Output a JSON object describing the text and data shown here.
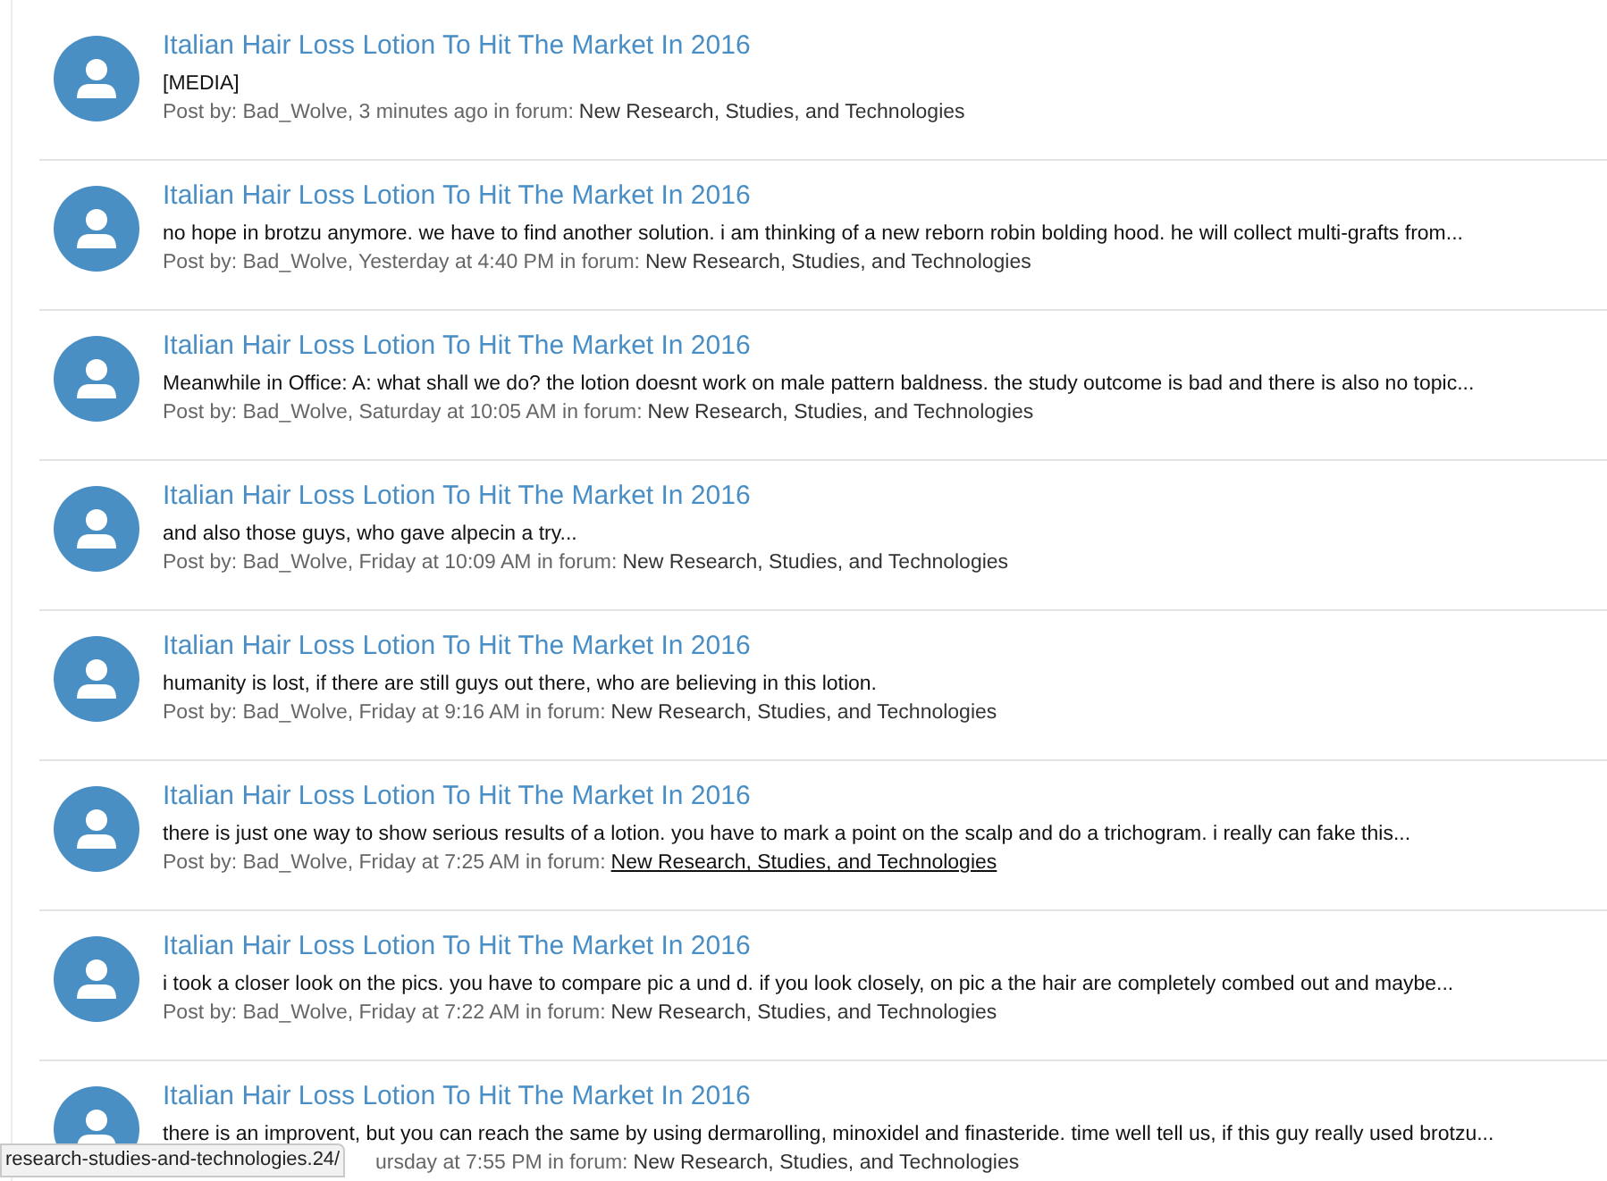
{
  "posts": [
    {
      "title": "Italian Hair Loss Lotion To Hit The Market In 2016",
      "snippet": "[MEDIA]",
      "meta": "Post by: Bad_Wolve, 3 minutes ago in forum:",
      "forum": "New Research, Studies, and Technologies",
      "forum_hovered": false
    },
    {
      "title": "Italian Hair Loss Lotion To Hit The Market In 2016",
      "snippet": "no hope in brotzu anymore. we have to find another solution. i am thinking of a new reborn robin bolding hood. he will collect multi-grafts from...",
      "meta": "Post by: Bad_Wolve, Yesterday at 4:40 PM in forum:",
      "forum": "New Research, Studies, and Technologies",
      "forum_hovered": false
    },
    {
      "title": "Italian Hair Loss Lotion To Hit The Market In 2016",
      "snippet": "Meanwhile in Office: A: what shall we do? the lotion doesnt work on male pattern baldness. the study outcome is bad and there is also no topic...",
      "meta": "Post by: Bad_Wolve, Saturday at 10:05 AM in forum:",
      "forum": "New Research, Studies, and Technologies",
      "forum_hovered": false
    },
    {
      "title": "Italian Hair Loss Lotion To Hit The Market In 2016",
      "snippet": "and also those guys, who gave alpecin a try...",
      "meta": "Post by: Bad_Wolve, Friday at 10:09 AM in forum:",
      "forum": "New Research, Studies, and Technologies",
      "forum_hovered": false
    },
    {
      "title": "Italian Hair Loss Lotion To Hit The Market In 2016",
      "snippet": "humanity is lost, if there are still guys out there, who are believing in this lotion.",
      "meta": "Post by: Bad_Wolve, Friday at 9:16 AM in forum:",
      "forum": "New Research, Studies, and Technologies",
      "forum_hovered": false
    },
    {
      "title": "Italian Hair Loss Lotion To Hit The Market In 2016",
      "snippet": "there is just one way to show serious results of a lotion. you have to mark a point on the scalp and do a trichogram. i really can fake this...",
      "meta": "Post by: Bad_Wolve, Friday at 7:25 AM in forum:",
      "forum": "New Research, Studies, and Technologies",
      "forum_hovered": true
    },
    {
      "title": "Italian Hair Loss Lotion To Hit The Market In 2016",
      "snippet": "i took a closer look on the pics. you have to compare pic a und d. if you look closely, on pic a the hair are completely combed out and maybe...",
      "meta": "Post by: Bad_Wolve, Friday at 7:22 AM in forum:",
      "forum": "New Research, Studies, and Technologies",
      "forum_hovered": false
    },
    {
      "title": "Italian Hair Loss Lotion To Hit The Market In 2016",
      "snippet": "there is an improvent, but you can reach the same by using dermarolling, minoxidel and finasteride. time well tell us, if this guy really used brotzu...",
      "meta": "ursday at 7:55 PM in forum:",
      "forum": "New Research, Studies, and Technologies",
      "forum_hovered": false
    }
  ],
  "status_bar": {
    "url": "research-studies-and-technologies.24/"
  }
}
